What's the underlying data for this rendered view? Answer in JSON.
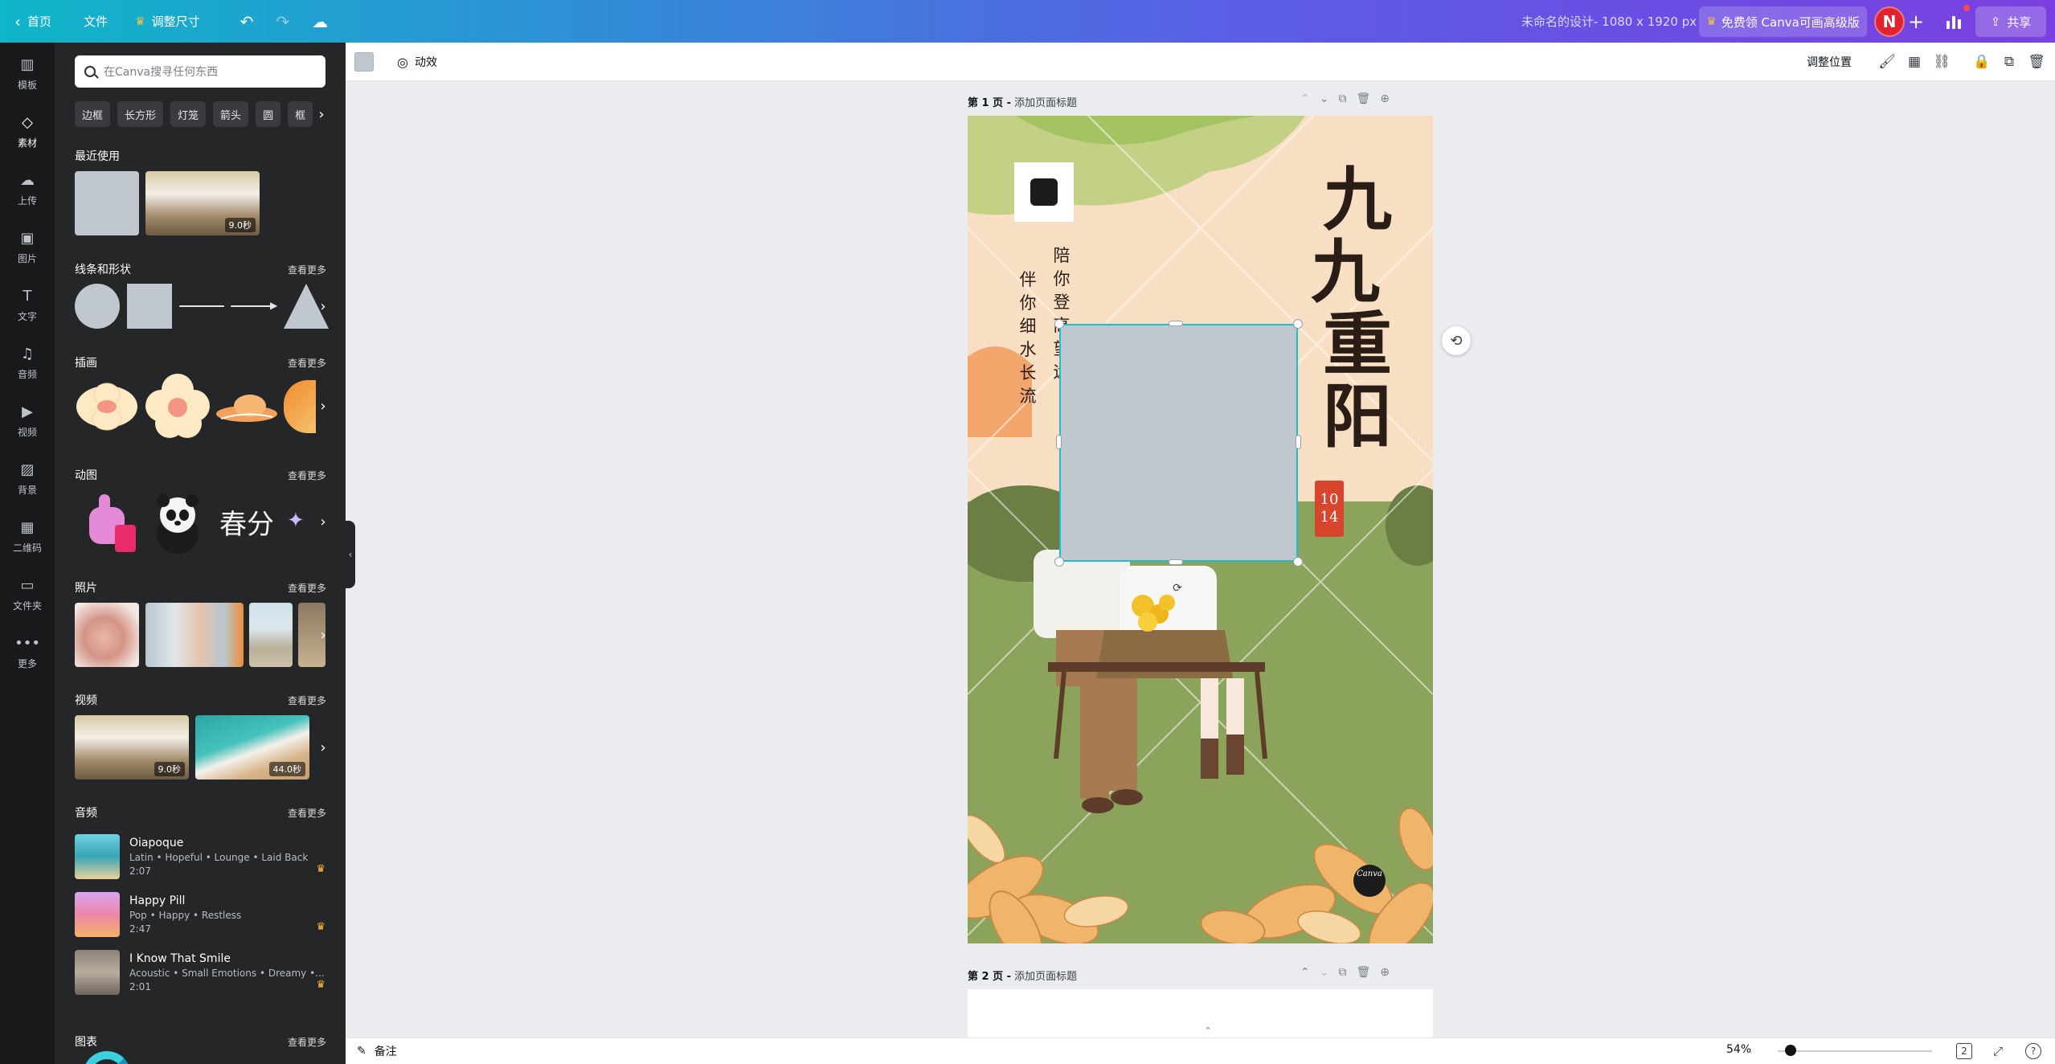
{
  "topbar": {
    "home": "首页",
    "file": "文件",
    "resize": "调整尺寸",
    "design_title": "未命名的设计- 1080 x 1920 px",
    "premium": "免费领 Canva可画高级版",
    "avatar_initial": "N",
    "share": "共享"
  },
  "rail": [
    {
      "label": "模板",
      "icon": "template-icon"
    },
    {
      "label": "素材",
      "icon": "elements-icon"
    },
    {
      "label": "上传",
      "icon": "upload-icon"
    },
    {
      "label": "图片",
      "icon": "photo-icon"
    },
    {
      "label": "文字",
      "icon": "text-icon"
    },
    {
      "label": "音频",
      "icon": "audio-icon"
    },
    {
      "label": "视频",
      "icon": "video-icon"
    },
    {
      "label": "背景",
      "icon": "background-icon"
    },
    {
      "label": "二维码",
      "icon": "qr-code-icon"
    },
    {
      "label": "文件夹",
      "icon": "folder-icon"
    },
    {
      "label": "更多",
      "icon": "more-icon"
    }
  ],
  "panel": {
    "search_placeholder": "在Canva搜寻任何东西",
    "chips": [
      "边框",
      "长方形",
      "灯笼",
      "箭头",
      "圆",
      "框"
    ],
    "recent": {
      "title": "最近使用",
      "video_duration": "9.0秒"
    },
    "shapes": {
      "title": "线条和形状",
      "more": "查看更多"
    },
    "illustrations": {
      "title": "插画",
      "more": "查看更多"
    },
    "stickers": {
      "title": "动图",
      "more": "查看更多",
      "calligraphy": "春分"
    },
    "photos": {
      "title": "照片",
      "more": "查看更多"
    },
    "videos": {
      "title": "视频",
      "more": "查看更多",
      "durations": [
        "9.0秒",
        "44.0秒"
      ]
    },
    "audio": {
      "title": "音频",
      "more": "查看更多",
      "tracks": [
        {
          "title": "Oiapoque",
          "tags": "Latin • Hopeful • Lounge • Laid Back",
          "length": "2:07"
        },
        {
          "title": "Happy Pill",
          "tags": "Pop • Happy • Restless",
          "length": "2:47"
        },
        {
          "title": "I Know That Smile",
          "tags": "Acoustic • Small Emotions • Dreamy •...",
          "length": "2:01"
        }
      ]
    },
    "charts": {
      "title": "图表",
      "more": "查看更多"
    }
  },
  "context_toolbar": {
    "swatch_color": "#c0c7ce",
    "animate": "动效",
    "position": "调整位置"
  },
  "canvas": {
    "page1_label": "第 1 页 -",
    "page1_title_placeholder": "添加页面标题",
    "page2_label": "第 2 页 -",
    "page2_title_placeholder": "添加页面标题",
    "poem_col1": [
      "伴",
      "你",
      "细",
      "水",
      "长",
      "流"
    ],
    "poem_col2": [
      "陪",
      "你",
      "登",
      "高",
      "望",
      "远"
    ],
    "title_chars": [
      "九",
      "九",
      "重",
      "阳"
    ],
    "date_top": "10",
    "date_bottom": "14",
    "logo": "Canva"
  },
  "bottombar": {
    "notes": "备注",
    "zoom": "54%",
    "page_count": "2"
  }
}
